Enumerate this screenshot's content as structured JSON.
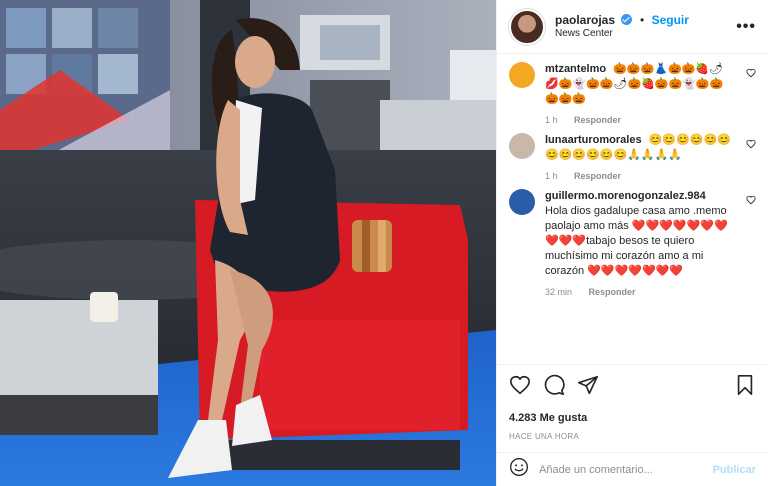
{
  "post": {
    "username": "paolarojas",
    "follow_label": "Seguir",
    "separator": "•",
    "location": "News Center",
    "more_label": "•••"
  },
  "comments": [
    {
      "username": "mtzantelmo",
      "text": "🎃🎃🎃👗🎃🎃🍓🌶💋🎃👻🎃🎃🌶🎃🍓🎃🎃👻🎃🎃🎃🎃🎃",
      "time": "1 h",
      "reply_label": "Responder",
      "avatar_color": "#f5a623"
    },
    {
      "username": "lunaarturomorales",
      "text": "😊😊😊😊😊😊😊😊😊😊😊😊🙏🙏🙏🙏",
      "time": "1 h",
      "reply_label": "Responder",
      "avatar_color": "#c8b8a8"
    },
    {
      "username": "guillermo.morenogonzalez.984",
      "text": "Hola dios gadalupe casa amo .memo paolajo amo más ❤️❤️❤️❤️❤️❤️❤️❤️❤️❤️tabajo besos te quiero muchísimo mi corazón amo a mi corazón ❤️❤️❤️❤️❤️❤️❤️",
      "time": "32 min",
      "reply_label": "Responder",
      "avatar_color": "#2a5caa"
    }
  ],
  "likes_text": "4.283 Me gusta",
  "timestamp": "Hace una hora",
  "comment_input": {
    "placeholder": "Añade un comentario...",
    "publish_label": "Publicar"
  },
  "colors": {
    "accent": "#0095f6",
    "verified": "#3897f0",
    "publish_disabled": "#b2dffc",
    "chair_red": "#e0202a"
  }
}
